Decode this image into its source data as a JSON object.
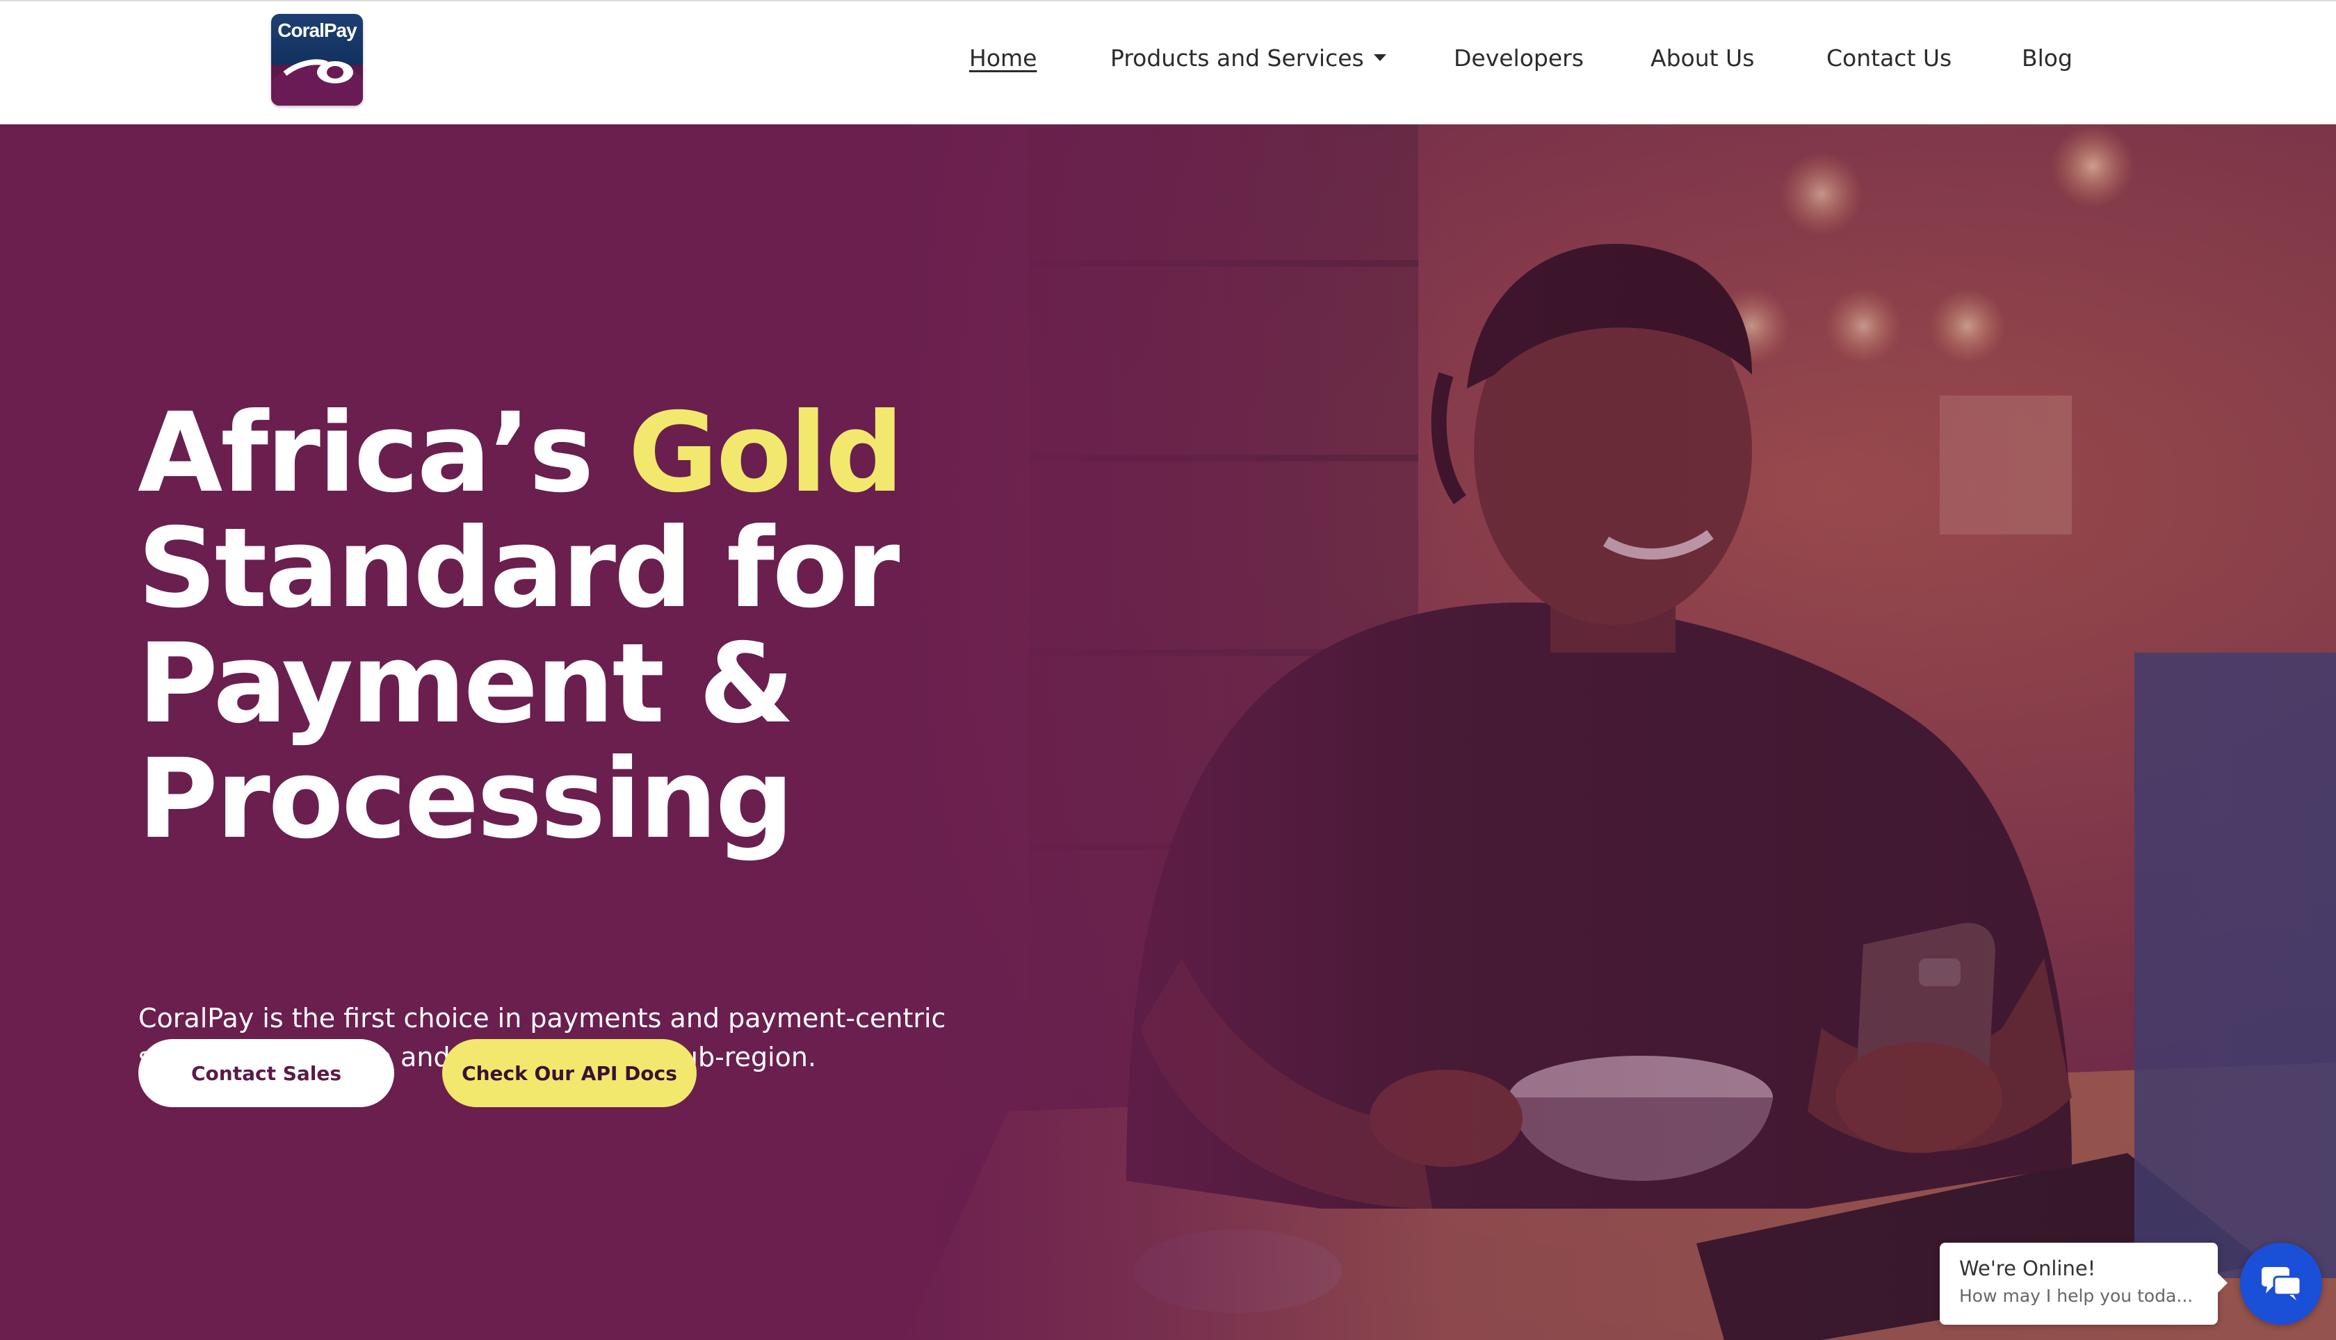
{
  "header": {
    "logo_text": "CoralPay",
    "nav": [
      {
        "label": "Home",
        "active": true
      },
      {
        "label": "Products and Services",
        "dropdown": true
      },
      {
        "label": "Developers"
      },
      {
        "label": "About Us"
      },
      {
        "label": "Contact Us"
      },
      {
        "label": "Blog"
      }
    ]
  },
  "hero": {
    "headline_part1": "Africa’s ",
    "headline_gold": "Gold",
    "headline_rest": " Standard for Payment & Processing",
    "subtext": "CoralPay is the first choice in payments and payment-centric solutions in Nigeria and the West Africa sub-region.",
    "buttons": {
      "contact_sales": "Contact Sales",
      "api_docs": "Check Our API Docs"
    }
  },
  "chat": {
    "title": "We're Online!",
    "subtitle": "How may I help you toda..."
  },
  "colors": {
    "brand_purple": "#6a1f4f",
    "gold": "#f2e86d",
    "chat_blue": "#1a4fd8"
  },
  "icons": [
    "caret-down-icon",
    "chat-icon"
  ]
}
